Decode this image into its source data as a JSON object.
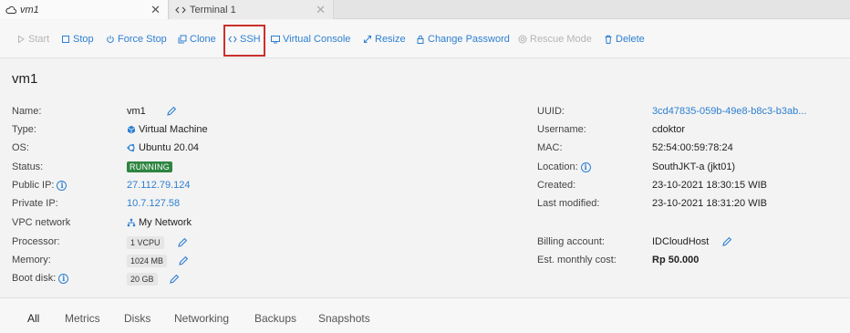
{
  "tabs": [
    {
      "label": "vm1",
      "icon": "cloud-icon",
      "active": true
    },
    {
      "label": "Terminal 1",
      "icon": "code-icon",
      "active": false
    }
  ],
  "toolbar": {
    "start": "Start",
    "stop": "Stop",
    "force_stop": "Force Stop",
    "clone": "Clone",
    "ssh": "SSH",
    "virtual_console": "Virtual Console",
    "resize": "Resize",
    "change_password": "Change Password",
    "rescue_mode": "Rescue Mode",
    "delete": "Delete"
  },
  "page_title": "vm1",
  "details_left": {
    "name_label": "Name:",
    "name": "vm1",
    "type_label": "Type:",
    "type": "Virtual Machine",
    "os_label": "OS:",
    "os": "Ubuntu 20.04",
    "status_label": "Status:",
    "status": "RUNNING",
    "public_ip_label": "Public IP:",
    "public_ip": "27.112.79.124",
    "private_ip_label": "Private IP:",
    "private_ip": "10.7.127.58",
    "vpc_label": "VPC network",
    "vpc": "My Network",
    "processor_label": "Processor:",
    "processor": "1 VCPU",
    "memory_label": "Memory:",
    "memory": "1024 MB",
    "boot_disk_label": "Boot disk:",
    "boot_disk": "20 GB"
  },
  "details_right": {
    "uuid_label": "UUID:",
    "uuid": "3cd47835-059b-49e8-b8c3-b3ab...",
    "username_label": "Username:",
    "username": "cdoktor",
    "mac_label": "MAC:",
    "mac": "52:54:00:59:78:24",
    "location_label": "Location:",
    "location": "SouthJKT-a (jkt01)",
    "created_label": "Created:",
    "created": "23-10-2021 18:30:15 WIB",
    "modified_label": "Last modified:",
    "modified": "23-10-2021 18:31:20 WIB",
    "billing_label": "Billing account:",
    "billing": "IDCloudHost",
    "cost_label": "Est. monthly cost:",
    "cost": "Rp 50.000"
  },
  "bottom_tabs": [
    "All",
    "Metrics",
    "Disks",
    "Networking",
    "Backups",
    "Snapshots"
  ],
  "colors": {
    "link": "#2d7fd1",
    "running": "#2e8540",
    "highlight": "#c9302c"
  }
}
